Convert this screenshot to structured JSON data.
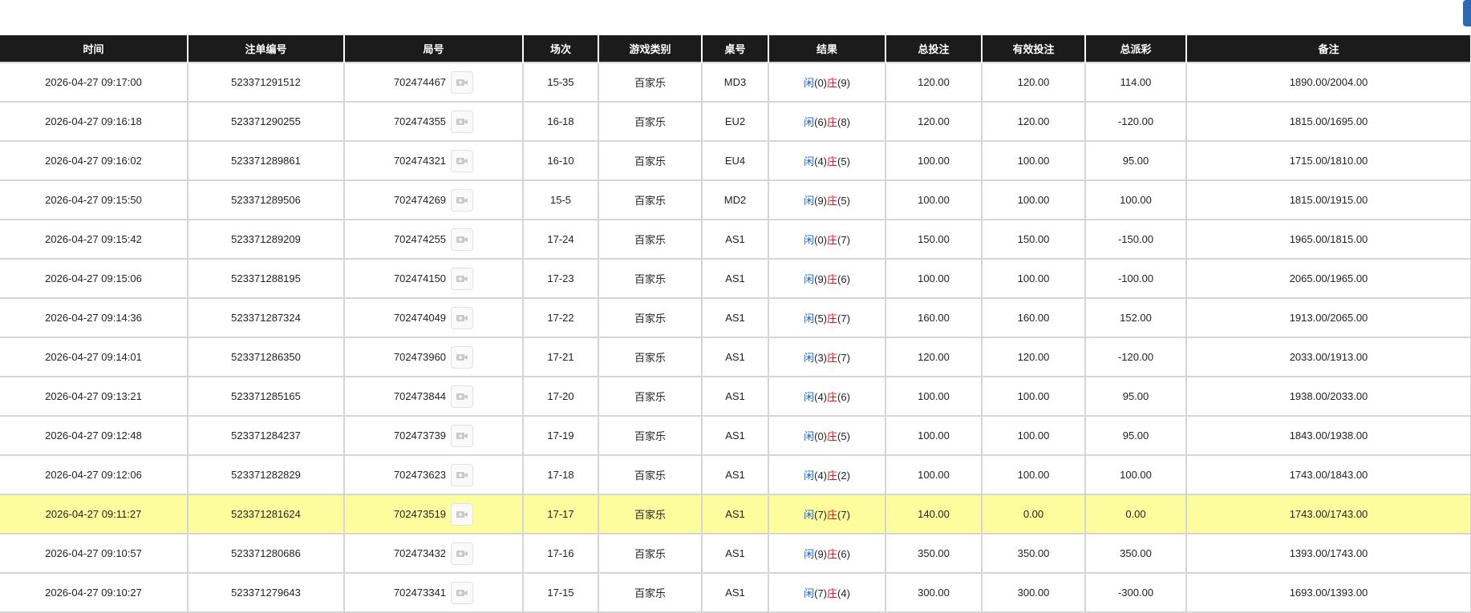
{
  "headers": [
    "时间",
    "注单编号",
    "局号",
    "场次",
    "游戏类别",
    "桌号",
    "结果",
    "总投注",
    "有效投注",
    "总派彩",
    "备注"
  ],
  "rows": [
    {
      "time": "2026-04-27 09:17:00",
      "order_id": "523371291512",
      "round": "702474467",
      "shoe": "15-35",
      "game": "百家乐",
      "table": "MD3",
      "player_label": "闲",
      "player_score": "(0)",
      "banker_label": "庄",
      "banker_score": "(9)",
      "total_bet": "120.00",
      "valid_bet": "120.00",
      "payout": "114.00",
      "payout_negative": false,
      "note": "1890.00/2004.00",
      "highlight": false
    },
    {
      "time": "2026-04-27 09:16:18",
      "order_id": "523371290255",
      "round": "702474355",
      "shoe": "16-18",
      "game": "百家乐",
      "table": "EU2",
      "player_label": "闲",
      "player_score": "(6)",
      "banker_label": "庄",
      "banker_score": "(8)",
      "total_bet": "120.00",
      "valid_bet": "120.00",
      "payout": "-120.00",
      "payout_negative": true,
      "note": "1815.00/1695.00",
      "highlight": false
    },
    {
      "time": "2026-04-27 09:16:02",
      "order_id": "523371289861",
      "round": "702474321",
      "shoe": "16-10",
      "game": "百家乐",
      "table": "EU4",
      "player_label": "闲",
      "player_score": "(4)",
      "banker_label": "庄",
      "banker_score": "(5)",
      "total_bet": "100.00",
      "valid_bet": "100.00",
      "payout": "95.00",
      "payout_negative": false,
      "note": "1715.00/1810.00",
      "highlight": false
    },
    {
      "time": "2026-04-27 09:15:50",
      "order_id": "523371289506",
      "round": "702474269",
      "shoe": "15-5",
      "game": "百家乐",
      "table": "MD2",
      "player_label": "闲",
      "player_score": "(9)",
      "banker_label": "庄",
      "banker_score": "(5)",
      "total_bet": "100.00",
      "valid_bet": "100.00",
      "payout": "100.00",
      "payout_negative": false,
      "note": "1815.00/1915.00",
      "highlight": false
    },
    {
      "time": "2026-04-27 09:15:42",
      "order_id": "523371289209",
      "round": "702474255",
      "shoe": "17-24",
      "game": "百家乐",
      "table": "AS1",
      "player_label": "闲",
      "player_score": "(0)",
      "banker_label": "庄",
      "banker_score": "(7)",
      "total_bet": "150.00",
      "valid_bet": "150.00",
      "payout": "-150.00",
      "payout_negative": true,
      "note": "1965.00/1815.00",
      "highlight": false
    },
    {
      "time": "2026-04-27 09:15:06",
      "order_id": "523371288195",
      "round": "702474150",
      "shoe": "17-23",
      "game": "百家乐",
      "table": "AS1",
      "player_label": "闲",
      "player_score": "(9)",
      "banker_label": "庄",
      "banker_score": "(6)",
      "total_bet": "100.00",
      "valid_bet": "100.00",
      "payout": "-100.00",
      "payout_negative": true,
      "note": "2065.00/1965.00",
      "highlight": false
    },
    {
      "time": "2026-04-27 09:14:36",
      "order_id": "523371287324",
      "round": "702474049",
      "shoe": "17-22",
      "game": "百家乐",
      "table": "AS1",
      "player_label": "闲",
      "player_score": "(5)",
      "banker_label": "庄",
      "banker_score": "(7)",
      "total_bet": "160.00",
      "valid_bet": "160.00",
      "payout": "152.00",
      "payout_negative": false,
      "note": "1913.00/2065.00",
      "highlight": false
    },
    {
      "time": "2026-04-27 09:14:01",
      "order_id": "523371286350",
      "round": "702473960",
      "shoe": "17-21",
      "game": "百家乐",
      "table": "AS1",
      "player_label": "闲",
      "player_score": "(3)",
      "banker_label": "庄",
      "banker_score": "(7)",
      "total_bet": "120.00",
      "valid_bet": "120.00",
      "payout": "-120.00",
      "payout_negative": true,
      "note": "2033.00/1913.00",
      "highlight": false
    },
    {
      "time": "2026-04-27 09:13:21",
      "order_id": "523371285165",
      "round": "702473844",
      "shoe": "17-20",
      "game": "百家乐",
      "table": "AS1",
      "player_label": "闲",
      "player_score": "(4)",
      "banker_label": "庄",
      "banker_score": "(6)",
      "total_bet": "100.00",
      "valid_bet": "100.00",
      "payout": "95.00",
      "payout_negative": false,
      "note": "1938.00/2033.00",
      "highlight": false
    },
    {
      "time": "2026-04-27 09:12:48",
      "order_id": "523371284237",
      "round": "702473739",
      "shoe": "17-19",
      "game": "百家乐",
      "table": "AS1",
      "player_label": "闲",
      "player_score": "(0)",
      "banker_label": "庄",
      "banker_score": "(5)",
      "total_bet": "100.00",
      "valid_bet": "100.00",
      "payout": "95.00",
      "payout_negative": false,
      "note": "1843.00/1938.00",
      "highlight": false
    },
    {
      "time": "2026-04-27 09:12:06",
      "order_id": "523371282829",
      "round": "702473623",
      "shoe": "17-18",
      "game": "百家乐",
      "table": "AS1",
      "player_label": "闲",
      "player_score": "(4)",
      "banker_label": "庄",
      "banker_score": "(2)",
      "total_bet": "100.00",
      "valid_bet": "100.00",
      "payout": "100.00",
      "payout_negative": false,
      "note": "1743.00/1843.00",
      "highlight": false
    },
    {
      "time": "2026-04-27 09:11:27",
      "order_id": "523371281624",
      "round": "702473519",
      "shoe": "17-17",
      "game": "百家乐",
      "table": "AS1",
      "player_label": "闲",
      "player_score": "(7)",
      "banker_label": "庄",
      "banker_score": "(7)",
      "total_bet": "140.00",
      "valid_bet": "0.00",
      "payout": "0.00",
      "payout_negative": false,
      "note": "1743.00/1743.00",
      "highlight": true
    },
    {
      "time": "2026-04-27 09:10:57",
      "order_id": "523371280686",
      "round": "702473432",
      "shoe": "17-16",
      "game": "百家乐",
      "table": "AS1",
      "player_label": "闲",
      "player_score": "(9)",
      "banker_label": "庄",
      "banker_score": "(6)",
      "total_bet": "350.00",
      "valid_bet": "350.00",
      "payout": "350.00",
      "payout_negative": false,
      "note": "1393.00/1743.00",
      "highlight": false
    },
    {
      "time": "2026-04-27 09:10:27",
      "order_id": "523371279643",
      "round": "702473341",
      "shoe": "17-15",
      "game": "百家乐",
      "table": "AS1",
      "player_label": "闲",
      "player_score": "(7)",
      "banker_label": "庄",
      "banker_score": "(4)",
      "total_bet": "300.00",
      "valid_bet": "300.00",
      "payout": "-300.00",
      "payout_negative": true,
      "note": "1693.00/1393.00",
      "highlight": false
    }
  ],
  "colors": {
    "header_bg": "#1b1b1b",
    "bet_blue": "#1463d6",
    "loss_red": "#e3111b",
    "highlight_row": "#fdfd9e",
    "corner_button": "#2d6ab3"
  },
  "icons": {
    "round_replay": "video-replay-icon"
  }
}
